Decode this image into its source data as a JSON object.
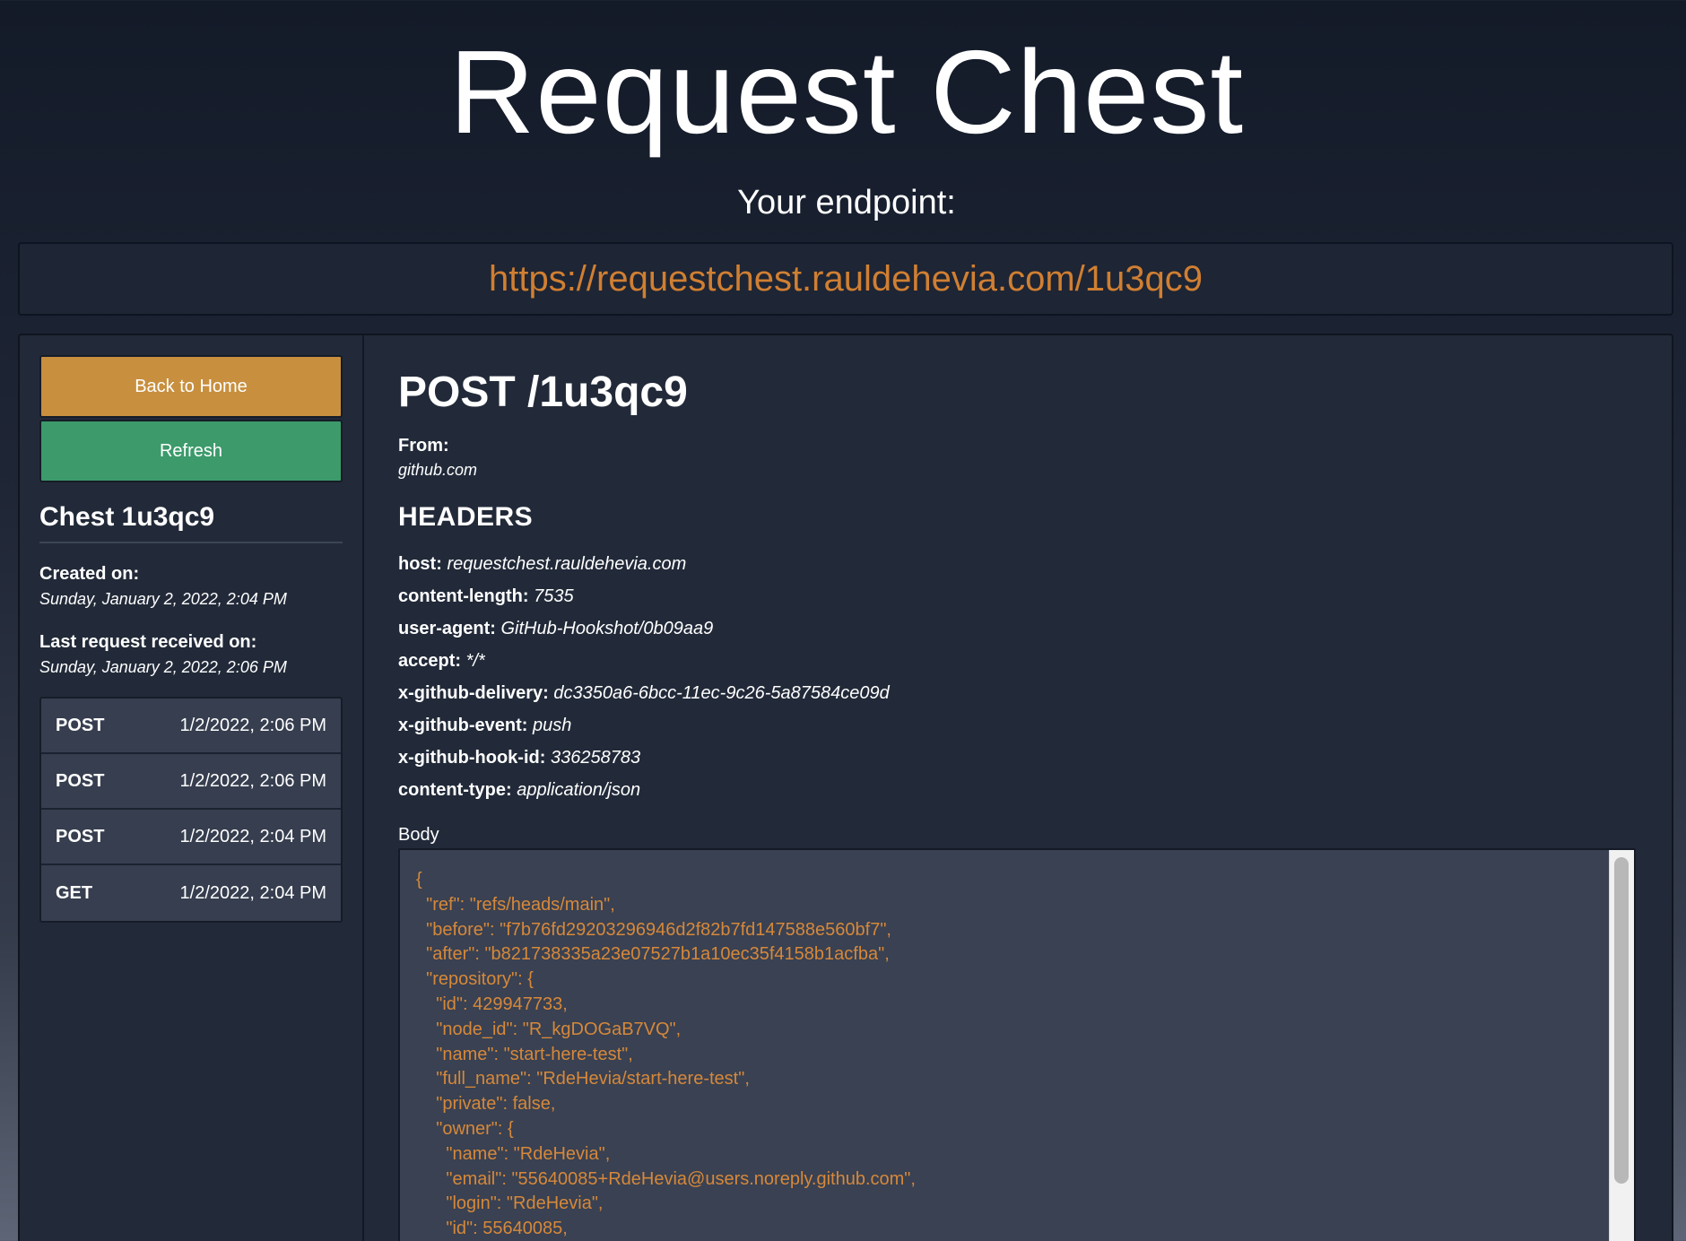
{
  "app": {
    "title": "Request Chest",
    "endpoint_label": "Your endpoint:",
    "endpoint_url": "https://requestchest.rauldehevia.com/1u3qc9"
  },
  "sidebar": {
    "back_home_label": "Back to Home",
    "refresh_label": "Refresh",
    "chest_title": "Chest 1u3qc9",
    "created_label": "Created on:",
    "created_value": "Sunday, January 2, 2022, 2:04 PM",
    "last_request_label": "Last request received on:",
    "last_request_value": "Sunday, January 2, 2022, 2:06 PM",
    "requests": [
      {
        "method": "POST",
        "time": "1/2/2022, 2:06 PM"
      },
      {
        "method": "POST",
        "time": "1/2/2022, 2:06 PM"
      },
      {
        "method": "POST",
        "time": "1/2/2022, 2:04 PM"
      },
      {
        "method": "GET",
        "time": "1/2/2022, 2:04 PM"
      }
    ]
  },
  "detail": {
    "heading": "POST /1u3qc9",
    "from_label": "From:",
    "from_value": "github.com",
    "headers_title": "HEADERS",
    "headers": [
      {
        "key": "host:",
        "value": "requestchest.rauldehevia.com"
      },
      {
        "key": "content-length:",
        "value": "7535"
      },
      {
        "key": "user-agent:",
        "value": "GitHub-Hookshot/0b09aa9"
      },
      {
        "key": "accept:",
        "value": "*/*"
      },
      {
        "key": "x-github-delivery:",
        "value": "dc3350a6-6bcc-11ec-9c26-5a87584ce09d"
      },
      {
        "key": "x-github-event:",
        "value": "push"
      },
      {
        "key": "x-github-hook-id:",
        "value": "336258783"
      },
      {
        "key": "content-type:",
        "value": "application/json"
      }
    ],
    "body_label": "Body",
    "body_text": "{\n  \"ref\": \"refs/heads/main\",\n  \"before\": \"f7b76fd29203296946d2f82b7fd147588e560bf7\",\n  \"after\": \"b821738335a23e07527b1a10ec35f4158b1acfba\",\n  \"repository\": {\n    \"id\": 429947733,\n    \"node_id\": \"R_kgDOGaB7VQ\",\n    \"name\": \"start-here-test\",\n    \"full_name\": \"RdeHevia/start-here-test\",\n    \"private\": false,\n    \"owner\": {\n      \"name\": \"RdeHevia\",\n      \"email\": \"55640085+RdeHevia@users.noreply.github.com\",\n      \"login\": \"RdeHevia\",\n      \"id\": 55640085,"
  }
}
